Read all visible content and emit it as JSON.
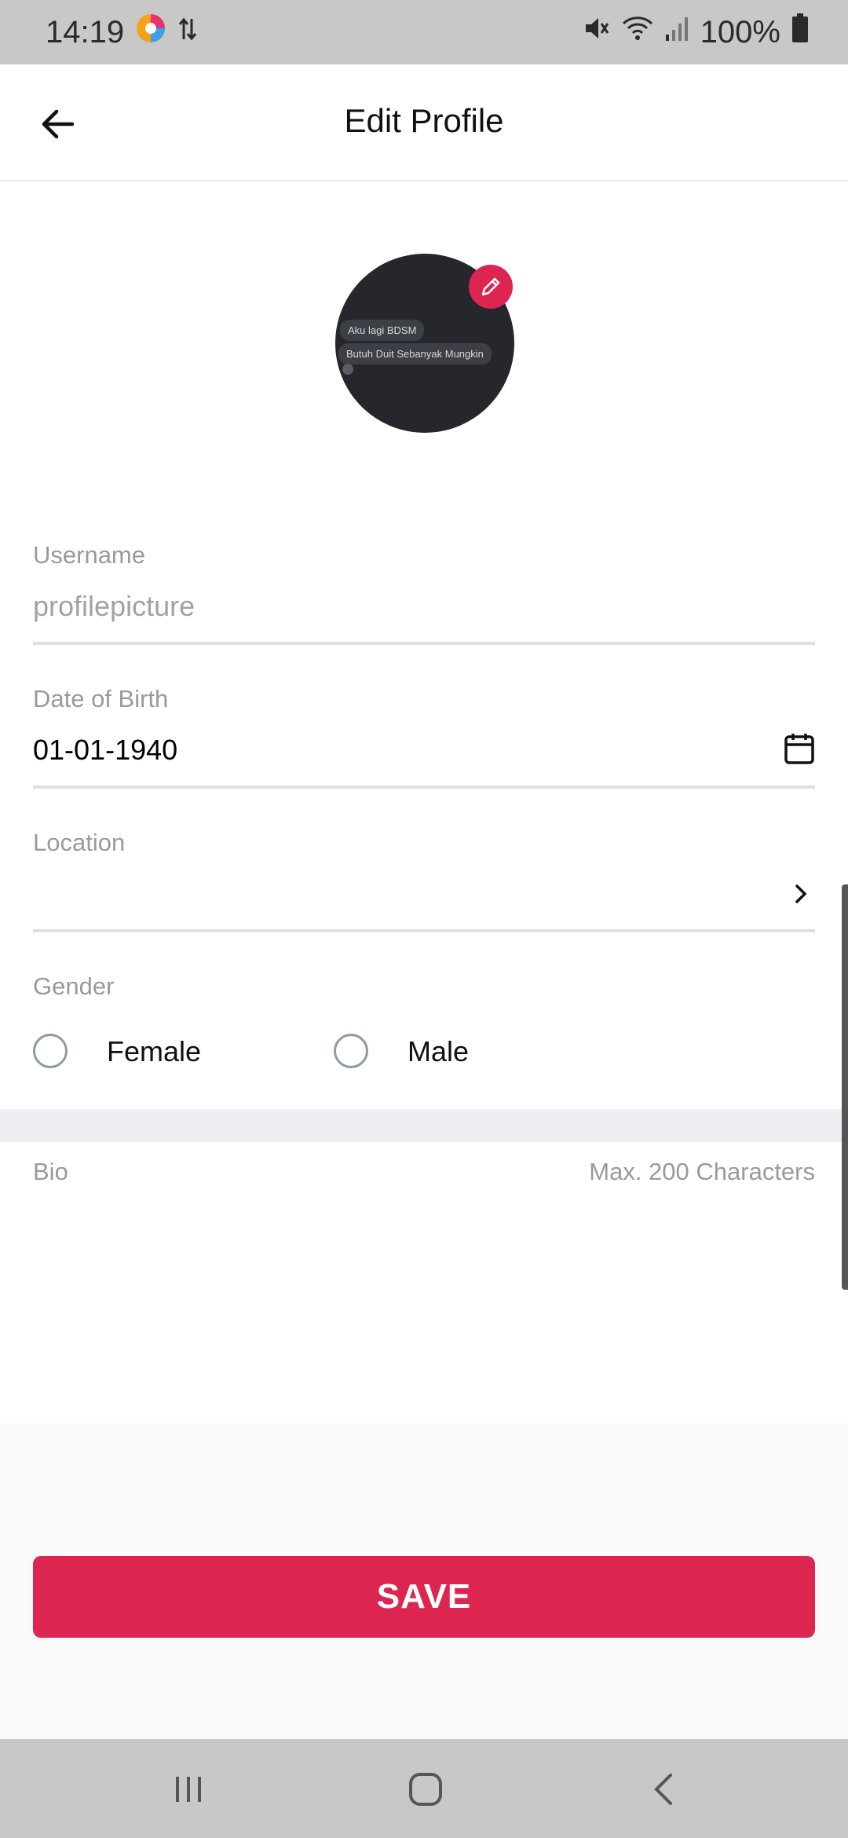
{
  "status_bar": {
    "time": "14:19",
    "battery": "100%"
  },
  "header": {
    "title": "Edit Profile"
  },
  "avatar": {
    "bubble1": "Aku lagi BDSM",
    "bubble2": "Butuh Duit Sebanyak Mungkin"
  },
  "form": {
    "username_label": "Username",
    "username_placeholder": "profilepicture",
    "dob_label": "Date of Birth",
    "dob_value": "01-01-1940",
    "location_label": "Location",
    "gender_label": "Gender",
    "gender_options": [
      "Female",
      "Male"
    ],
    "bio_label": "Bio",
    "bio_hint": "Max. 200 Characters"
  },
  "actions": {
    "save_label": "SAVE"
  },
  "colors": {
    "accent": "#dc2650",
    "label": "#9a9a9a"
  }
}
